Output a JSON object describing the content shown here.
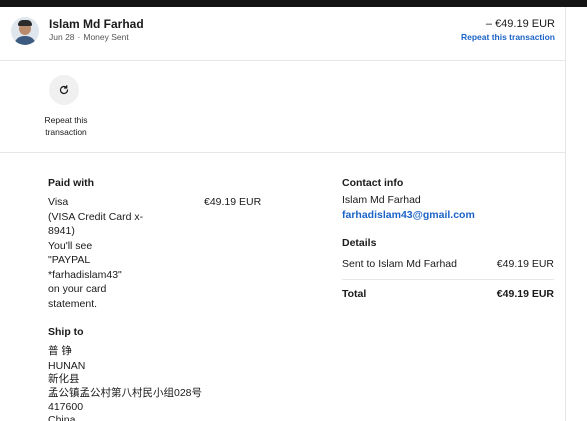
{
  "header": {
    "name": "Islam Md Farhad",
    "date": "Jun 28",
    "separator": "·",
    "type": "Money Sent",
    "amount": "– €49.19 EUR",
    "repeat_link": "Repeat this transaction"
  },
  "actions": {
    "repeat_label": "Repeat this transaction"
  },
  "paid_with": {
    "title": "Paid with",
    "lines": [
      "Visa",
      "(VISA Credit Card x-",
      "8941)",
      "You'll see",
      "\"PAYPAL",
      "*farhadislam43\"",
      "on your card",
      "statement."
    ],
    "amount": "€49.19 EUR"
  },
  "ship_to": {
    "title": "Ship to",
    "lines": [
      "普 铮",
      "HUNAN",
      "新化县",
      "孟公镇孟公村第八村民小组028号",
      "417600",
      "China"
    ]
  },
  "contact": {
    "title": "Contact info",
    "name": "Islam Md Farhad",
    "email": "farhadislam43@gmail.com"
  },
  "details": {
    "title": "Details",
    "sent_label": "Sent to Islam Md Farhad",
    "sent_amount": "€49.19 EUR",
    "total_label": "Total",
    "total_amount": "€49.19 EUR"
  },
  "colors": {
    "link": "#1b63c6",
    "topbar": "#141414"
  }
}
